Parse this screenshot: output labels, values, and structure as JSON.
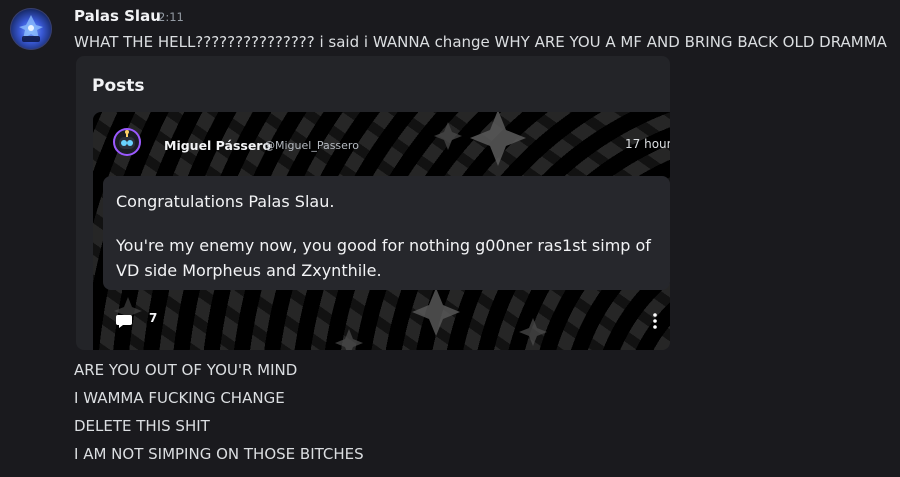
{
  "message": {
    "author": "Palas Slau",
    "timestamp": "2:11",
    "text": "WHAT THE HELL??????????????? i said i WANNA change WHY ARE YOU A MF AND BRING BACK OLD DRAMMA"
  },
  "embed": {
    "title": "Posts",
    "post": {
      "author_name": "Miguel Pássero",
      "author_handle": "@Miguel_Passero",
      "time": "17 hour",
      "line1": "Congratulations Palas Slau.",
      "line2": "You're my enemy now, you good for nothing g00ner ras1st simp of VD side Morpheus and Zxynthile.",
      "comment_count": "7"
    }
  },
  "followups": [
    "ARE YOU OUT OF YOU'R MIND",
    "I WAMMA FUCKING CHANGE",
    "DELETE THIS SHIT",
    "I AM NOT SIMPING ON THOSE BITCHES"
  ],
  "icons": {
    "avatar": "user-avatar-icon",
    "post_avatar": "robot-avatar-icon",
    "comment": "comment-icon",
    "more": "more-vertical-icon"
  },
  "colors": {
    "background": "#1a1a1e",
    "embed": "#232428",
    "card": "#26272c",
    "accent": "#9b59ff"
  }
}
